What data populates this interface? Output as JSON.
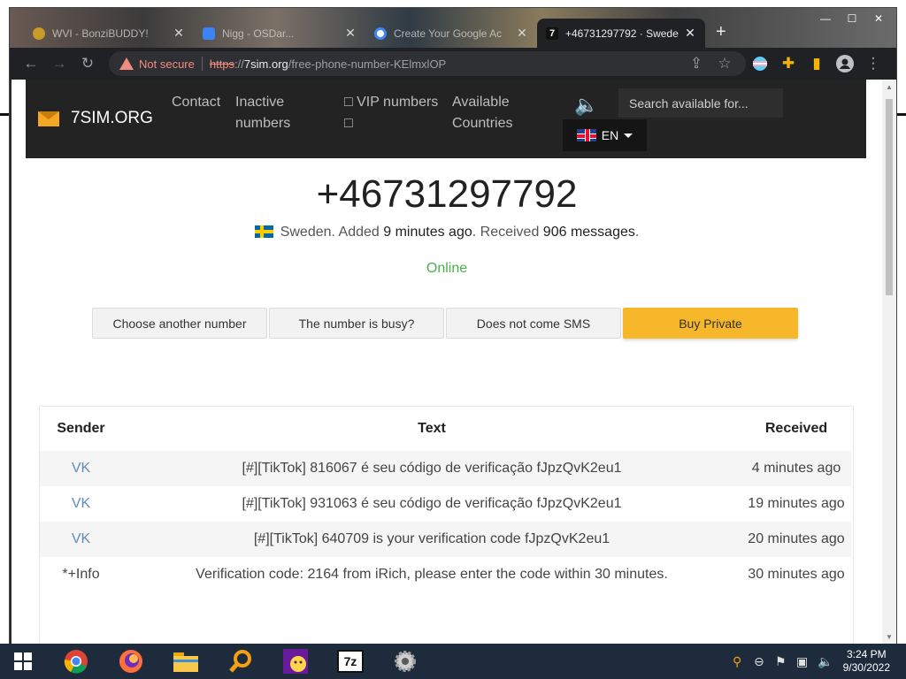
{
  "browser": {
    "tabs": [
      {
        "title": "WVI - BonziBUDDY!",
        "active": false
      },
      {
        "title": "Nigg - OSDar...",
        "active": false
      },
      {
        "title": "Create Your Google Ac",
        "active": false
      },
      {
        "title": "+46731297792 · Swede",
        "active": true
      }
    ],
    "new_tab_label": "+",
    "window_controls": {
      "minimize": "—",
      "maximize": "☐",
      "close": "✕"
    },
    "address": {
      "security_label": "Not secure",
      "scheme": "https",
      "separator": "://",
      "host": "7sim.org",
      "path": "/free-phone-number-KElmxlOP"
    }
  },
  "site": {
    "logo_text": "7SIM.ORG",
    "nav": {
      "contact": "Contact",
      "inactive": "Inactive numbers",
      "vip": "□ VIP numbers □",
      "available": "Available Countries"
    },
    "search_placeholder": "Search available for...",
    "language": "EN"
  },
  "number": {
    "phone": "+46731297792",
    "country": "Sweden",
    "added_prefix": ". Added ",
    "added_value": "9 minutes ago",
    "received_prefix": ". Received ",
    "received_value": "906 messages",
    "suffix": ".",
    "status": "Online"
  },
  "actions": {
    "choose_another": "Choose another number",
    "busy": "The number is busy?",
    "no_sms": "Does not come SMS",
    "buy_private": "Buy Private"
  },
  "messages": {
    "headers": {
      "sender": "Sender",
      "text": "Text",
      "received": "Received"
    },
    "rows": [
      {
        "sender": "VK",
        "text": "[#][TikTok] 816067 é seu código de verificação fJpzQvK2eu1",
        "received": "4 minutes ago"
      },
      {
        "sender": "VK",
        "text": "[#][TikTok] 931063 é seu código de verificação fJpzQvK2eu1",
        "received": "19 minutes ago"
      },
      {
        "sender": "VK",
        "text": "[#][TikTok] 640709 is your verification code fJpzQvK2eu1",
        "received": "20 minutes ago"
      },
      {
        "sender": "*+Info",
        "text": "Verification code: 2164 from iRich, please enter the code within 30 minutes.",
        "received": "30 minutes ago"
      }
    ]
  },
  "taskbar": {
    "apps": [
      "start-icon",
      "chrome-icon",
      "firefox-icon",
      "file-explorer-icon",
      "search-tool-icon",
      "yahoo-messenger-icon",
      "7zip-icon",
      "settings-gear-icon"
    ],
    "seven_zip_label": "7z",
    "time": "3:24 PM",
    "date": "9/30/2022"
  },
  "colors": {
    "accent": "#f6b72a",
    "header_bg": "#232323",
    "online": "#4caf50",
    "sender_link": "#5b8db8"
  }
}
